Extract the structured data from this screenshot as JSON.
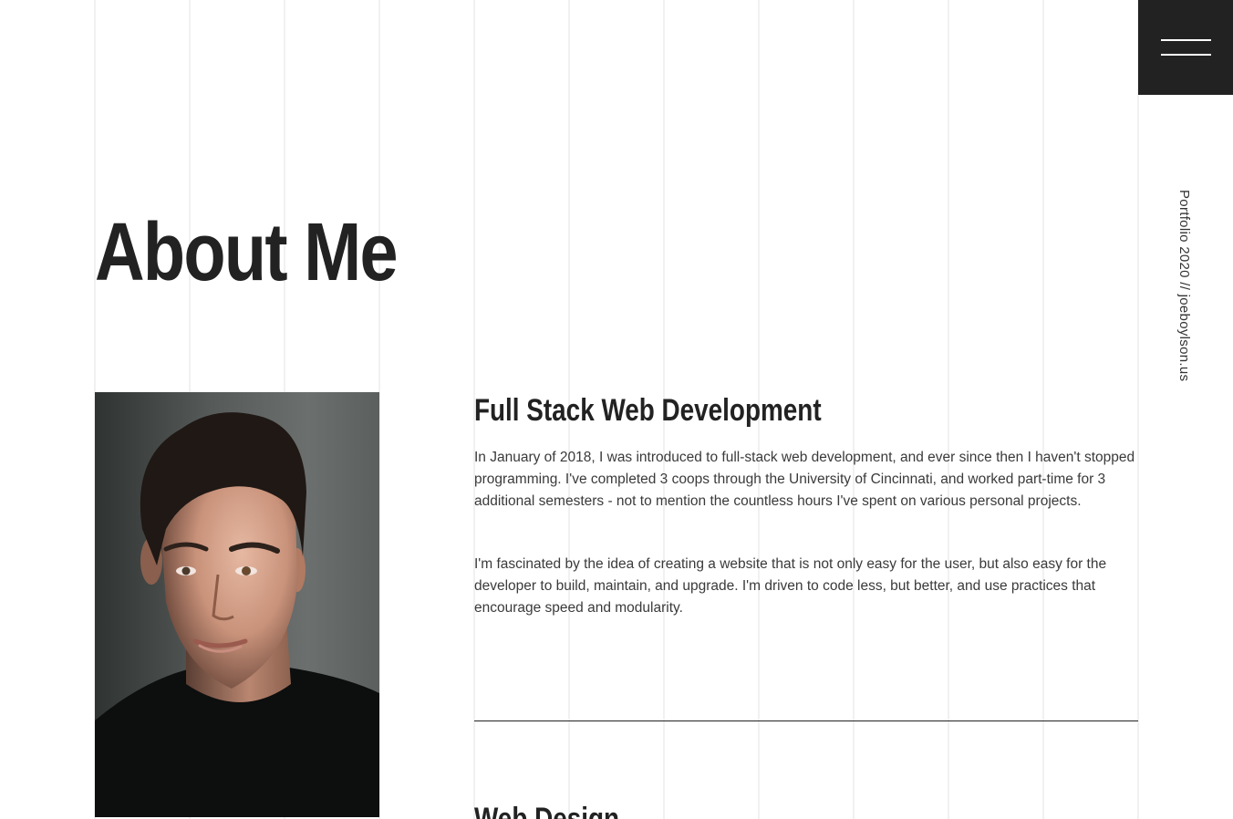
{
  "side_text": "Portfolio 2020  //  joeboylson.us",
  "page_title": "About Me",
  "sections": [
    {
      "title": "Full Stack Web Development",
      "paragraphs": [
        "In January of 2018, I was introduced to full-stack web development, and ever since then I haven't stopped programming. I've completed 3 coops through the University of Cincinnati, and worked part-time for 3 additional semesters - not to mention the countless hours I've spent on various personal projects.",
        "I'm fascinated by the idea of creating a website that is not only easy for the user, but also easy for the developer to build, maintain, and upgrade. I'm driven to code less, but better, and use practices that encourage speed and modularity."
      ]
    },
    {
      "title": "Web Design"
    }
  ],
  "colors": {
    "text": "#222222",
    "menu_background": "#222222",
    "grid_line": "#f1f1f1",
    "background": "#ffffff"
  },
  "icons": {
    "menu": "hamburger-menu-icon"
  }
}
